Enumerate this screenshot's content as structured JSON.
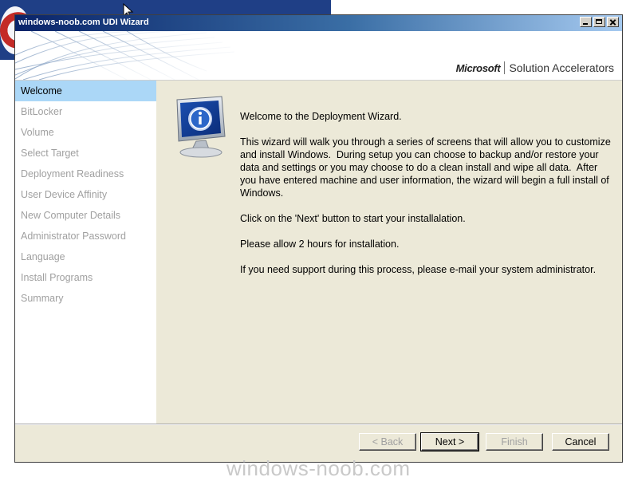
{
  "window": {
    "title": "windows-noob.com UDI Wizard"
  },
  "brand": {
    "company": "Microsoft",
    "product": "Solution Accelerators"
  },
  "nav": {
    "items": [
      {
        "label": "Welcome",
        "active": true
      },
      {
        "label": "BitLocker",
        "active": false
      },
      {
        "label": "Volume",
        "active": false
      },
      {
        "label": "Select Target",
        "active": false
      },
      {
        "label": "Deployment Readiness",
        "active": false
      },
      {
        "label": "User Device Affinity",
        "active": false
      },
      {
        "label": "New Computer Details",
        "active": false
      },
      {
        "label": "Administrator Password",
        "active": false
      },
      {
        "label": "Language",
        "active": false
      },
      {
        "label": "Install Programs",
        "active": false
      },
      {
        "label": "Summary",
        "active": false
      }
    ]
  },
  "content": {
    "icon": "info-monitor-icon",
    "paragraphs": [
      "Welcome to the Deployment Wizard.",
      "This wizard will walk you through a series of screens that will allow you to customize and install Windows.  During setup you can choose to backup and/or restore your data and settings or you may choose to do a clean install and wipe all data.  After you have entered machine and user information, the wizard will begin a full install of Windows.",
      "Click on the 'Next' button to start your installalation.",
      "Please allow 2 hours for installation.",
      "If you need support during this process, please e-mail your system administrator."
    ]
  },
  "buttons": {
    "back": "< Back",
    "next": "Next >",
    "finish": "Finish",
    "cancel": "Cancel"
  },
  "watermark": "windows-noob.com",
  "colors": {
    "nav_active": "#abd7f7",
    "panel_bg": "#ece9d8",
    "title_gradient_start": "#0a246a"
  }
}
